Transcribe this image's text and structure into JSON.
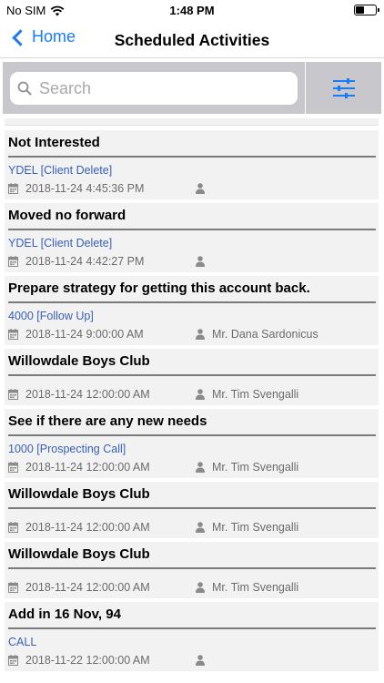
{
  "status_bar": {
    "carrier": "No SIM",
    "time": "1:48 PM"
  },
  "nav": {
    "back_label": "Home",
    "title": "Scheduled Activities"
  },
  "search": {
    "placeholder": "Search",
    "value": ""
  },
  "activities": [
    {
      "title": "Not Interested",
      "type": "YDEL [Client Delete]",
      "datetime": "2018-11-24 4:45:36 PM",
      "person": ""
    },
    {
      "title": "Moved no forward",
      "type": "YDEL [Client Delete]",
      "datetime": "2018-11-24 4:42:27 PM",
      "person": ""
    },
    {
      "title": "Prepare strategy for getting this account back.",
      "type": "4000 [Follow Up]",
      "datetime": "2018-11-24 9:00:00 AM",
      "person": "Mr. Dana Sardonicus"
    },
    {
      "title": "Willowdale Boys Club",
      "type": "",
      "datetime": "2018-11-24 12:00:00 AM",
      "person": "Mr. Tim Svengalli"
    },
    {
      "title": "See if there are any new needs",
      "type": "1000 [Prospecting Call]",
      "datetime": "2018-11-24 12:00:00 AM",
      "person": "Mr. Tim Svengalli"
    },
    {
      "title": "Willowdale Boys Club",
      "type": "",
      "datetime": "2018-11-24 12:00:00 AM",
      "person": "Mr. Tim Svengalli"
    },
    {
      "title": "Willowdale Boys Club",
      "type": "",
      "datetime": "2018-11-24 12:00:00 AM",
      "person": "Mr. Tim Svengalli"
    },
    {
      "title": "Add in 16 Nov, 94",
      "type": "CALL",
      "datetime": "2018-11-22 12:00:00 AM",
      "person": ""
    }
  ],
  "colors": {
    "accent": "#1a7cf5",
    "type_link": "#3860b5",
    "card_bg": "#f2f2f2",
    "search_bar_bg": "#c8c7cc"
  }
}
